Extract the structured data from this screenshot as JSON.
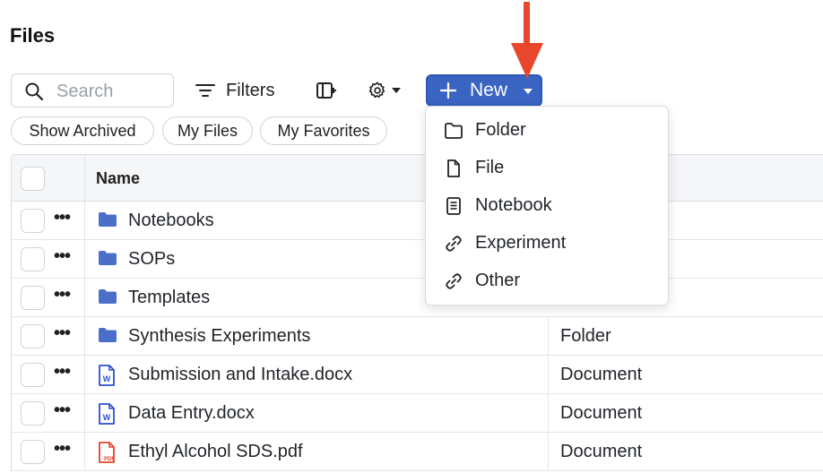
{
  "page": {
    "title": "Files"
  },
  "toolbar": {
    "search_placeholder": "Search",
    "filters_label": "Filters",
    "new_label": "New"
  },
  "chips": [
    "Show Archived",
    "My Files",
    "My Favorites"
  ],
  "table": {
    "header_name": "Name",
    "rows": [
      {
        "name": "Notebooks",
        "type": "",
        "icon": "folder-icon"
      },
      {
        "name": "SOPs",
        "type": "",
        "icon": "folder-icon"
      },
      {
        "name": "Templates",
        "type": "",
        "icon": "folder-icon"
      },
      {
        "name": "Synthesis Experiments",
        "type": "Folder",
        "icon": "folder-icon"
      },
      {
        "name": "Submission and Intake.docx",
        "type": "Document",
        "icon": "word-doc-icon"
      },
      {
        "name": "Data Entry.docx",
        "type": "Document",
        "icon": "word-doc-icon"
      },
      {
        "name": "Ethyl Alcohol SDS.pdf",
        "type": "Document",
        "icon": "pdf-icon"
      }
    ]
  },
  "new_menu": {
    "items": [
      {
        "label": "Folder",
        "icon": "folder-outline-icon"
      },
      {
        "label": "File",
        "icon": "file-icon"
      },
      {
        "label": "Notebook",
        "icon": "notebook-icon"
      },
      {
        "label": "Experiment",
        "icon": "link-icon"
      },
      {
        "label": "Other",
        "icon": "link-icon"
      }
    ]
  },
  "colors": {
    "accent": "#3a64c2",
    "folder": "#4a6fc9",
    "word": "#2b4fd1",
    "pdf": "#e0442f",
    "annotation_arrow": "#e8472b"
  }
}
